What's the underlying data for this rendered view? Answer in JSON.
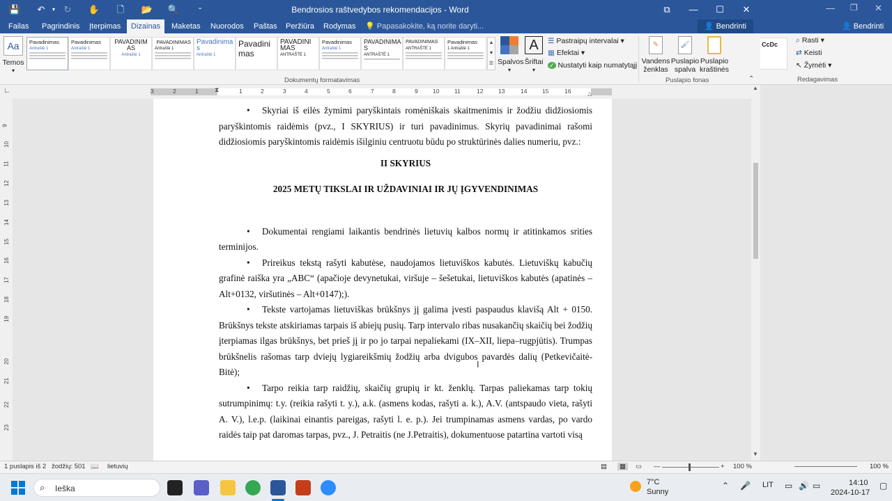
{
  "window": {
    "title": "Bendrosios raštvedybos rekomendacijos - Word",
    "share_label": "Bendrinti"
  },
  "tabs": [
    "Failas",
    "Pagrindinis",
    "Įterpimas",
    "Dizainas",
    "Maketas",
    "Nuorodos",
    "Paštas",
    "Peržiūra",
    "Rodymas"
  ],
  "tell_me": "Papasakokite, ką norite daryti...",
  "ribbon": {
    "themes_label": "Temos",
    "thumbs": [
      {
        "title": "Pavadinimas",
        "sub": "Antraštė 1"
      },
      {
        "title": "Pavadinimas",
        "sub": "Antraštė 1"
      },
      {
        "title": "PAVADINIM AS",
        "sub": "Antraštė 1"
      },
      {
        "title": "PAVADINIMAS",
        "sub": "Antraštė 1"
      },
      {
        "title": "Pavadinima s",
        "sub": "Antraštė 1"
      },
      {
        "title": "Pavadini mas",
        "sub": ""
      },
      {
        "title": "PAVADINI MAS",
        "sub": "ANTRAŠTĖ 1"
      },
      {
        "title": "Pavadinimas",
        "sub": "Antraštė 1"
      },
      {
        "title": "PAVADINIMA S",
        "sub": "ANTRAŠTĖ 1"
      },
      {
        "title": "PAVADINIMAS",
        "sub": "ANTRAŠTĖ 1"
      },
      {
        "title": "Pavadinimas",
        "sub": "1 Antraštė 1"
      },
      {
        "title": "Pavadinimas",
        "sub": "Antraštė 1"
      }
    ],
    "colors_label": "Spalvos",
    "fonts_label": "Šriftai",
    "paragraph_spacing": "Pastraipų intervalai",
    "effects": "Efektai",
    "set_default": "Nustatyti kaip numatytąjį",
    "group_doc_format": "Dokumentų formatavimas",
    "watermark_label": "Vandens ženklas",
    "page_color_label": "Puslapio spalva",
    "page_borders_label": "Puslapio kraštinės",
    "group_page_bg": "Puslapio fonas"
  },
  "ruler_numbers": [
    "3",
    "2",
    "1",
    "1",
    "2",
    "3",
    "4",
    "5",
    "6",
    "7",
    "8",
    "9",
    "10",
    "11",
    "12",
    "13",
    "14",
    "15",
    "16"
  ],
  "vruler_numbers": [
    "9",
    "10",
    "11",
    "12",
    "13",
    "14",
    "15",
    "16",
    "17",
    "18",
    "19",
    "20",
    "21",
    "22",
    "23"
  ],
  "document": {
    "p1": "Skyriai iš eilės žymimi paryškintais romėniškais skaitmenimis ir žodžiu didžiosiomis paryškintomis raidėmis (pvz., I SKYRIUS) ir turi pavadinimus. Skyrių pavadinimai rašomi didžiosiomis paryškintomis raidėmis išilginiu centruotu būdu po struktūrinės dalies numeriu, pvz.:",
    "h1": "II SKYRIUS",
    "h2": "2025 METŲ TIKSLAI IR UŽDAVINIAI IR JŲ ĮGYVENDINIMAS",
    "p2": "Dokumentai rengiami laikantis bendrinės lietuvių kalbos normų ir atitinkamos srities terminijos.",
    "p3": "Prireikus tekstą rašyti kabutėse, naudojamos lietuviškos kabutės. Lietuviškų kabučių grafinė raiška yra „ABC“ (apačioje devynetukai, viršuje – šešetukai, lietuviškos kabutės (apatinės – Alt+0132, viršutinės – Alt+0147);).",
    "p4": "Tekste vartojamas lietuviškas brūkšnys jį galima įvesti paspaudus klavišą Alt + 0150. Brūkšnys tekste atskiriamas tarpais iš abiejų pusių. Tarp intervalo ribas nusakančių skaičių bei žodžių įterpiamas ilgas brūkšnys, bet prieš jį ir po jo tarpai nepaliekami (IX–XII, liepa–rugpjūtis). Trumpas brūkšnelis rašomas tarp dviejų lygiareikšmių žodžių arba dvigubos pavardės dalių (Petkevičaitė-Bitė);",
    "p5": "Tarpo reikia tarp raidžių, skaičių grupių ir kt. ženklų. Tarpas paliekamas tarp tokių sutrumpinimų: t.y. (reikia rašyti t. y.), a.k. (asmens kodas, rašyti a. k.), A.V. (antspaudo vieta, rašyti A. V.), l.e.p. (laikinai einantis pareigas, rašyti l. e. p.). Jei trumpinamas asmens vardas, po vardo raidės taip pat daromas tarpas, pvz., J. Petraitis (ne J.Petraitis), dokumentuose patartina vartoti visą"
  },
  "status": {
    "page": "1 puslapis iš 2",
    "words": "žodžių: 501",
    "language": "lietuvių",
    "zoom": "100 %"
  },
  "bg_window": {
    "share_label": "Bendrinti",
    "find": "Rasti",
    "replace": "Keisti",
    "select": "Žymėti",
    "group_edit": "Redagavimas",
    "zoom": "100 %"
  },
  "taskbar": {
    "search_placeholder": "Ieška",
    "weather_temp": "7°C",
    "weather_desc": "Sunny",
    "lang": "LIT",
    "time": "14:10",
    "date": "2024-10-17"
  }
}
